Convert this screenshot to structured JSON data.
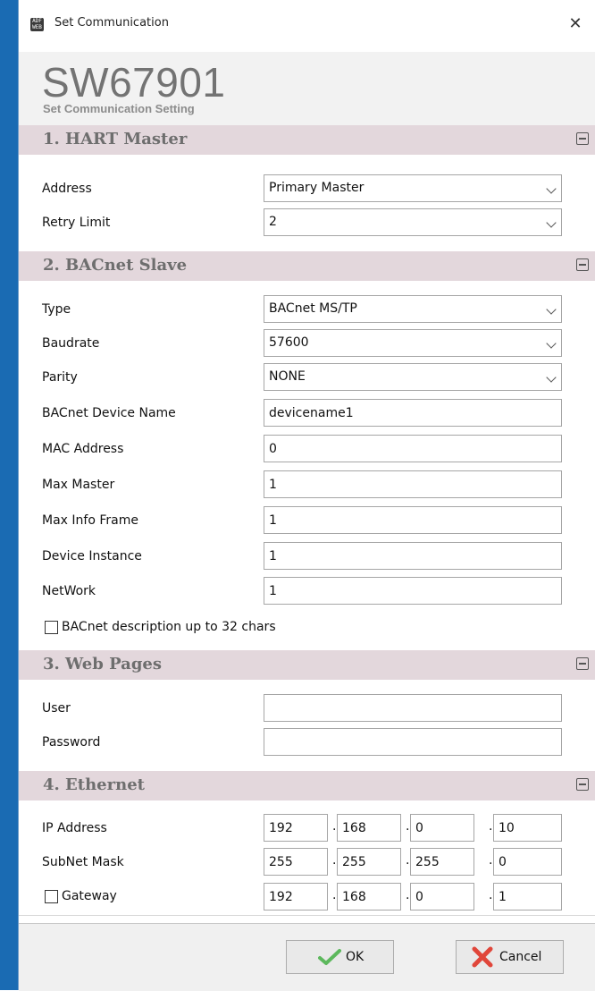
{
  "window": {
    "title": "Set Communication",
    "app_icon_text": "ADF WEB"
  },
  "header": {
    "code": "SW67901",
    "subtitle": "Set Communication Setting"
  },
  "hart": {
    "title": "1. HART Master",
    "address_label": "Address",
    "address_value": "Primary Master",
    "retry_label": "Retry Limit",
    "retry_value": "2"
  },
  "bacnet": {
    "title": "2. BACnet Slave",
    "type_label": "Type",
    "type_value": "BACnet MS/TP",
    "baud_label": "Baudrate",
    "baud_value": "57600",
    "parity_label": "Parity",
    "parity_value": "NONE",
    "devname_label": "BACnet Device Name",
    "devname_value": "devicename1",
    "mac_label": "MAC Address",
    "mac_value": "0",
    "maxmaster_label": "Max Master",
    "maxmaster_value": "1",
    "maxinfo_label": "Max Info Frame",
    "maxinfo_value": "1",
    "devinst_label": "Device Instance",
    "devinst_value": "1",
    "network_label": "NetWork",
    "network_value": "1",
    "desc32_label": "BACnet description up to 32 chars",
    "desc32_checked": false
  },
  "web": {
    "title": "3. Web Pages",
    "user_label": "User",
    "user_value": "",
    "password_label": "Password",
    "password_value": ""
  },
  "ethernet": {
    "title": "4. Ethernet",
    "ip_label": "IP Address",
    "ip": [
      "192",
      "168",
      "0",
      "10"
    ],
    "mask_label": "SubNet Mask",
    "mask": [
      "255",
      "255",
      "255",
      "0"
    ],
    "gateway_label": "Gateway",
    "gateway_checked": false,
    "gateway": [
      "192",
      "168",
      "0",
      "1"
    ],
    "separator": "."
  },
  "footer": {
    "ok_label": "OK",
    "cancel_label": "Cancel"
  },
  "colors": {
    "accent_stripe": "#1a6bb3",
    "section_bg": "#e3d7dc",
    "ok_check": "#5cb85c",
    "cancel_x": "#e0463a"
  }
}
